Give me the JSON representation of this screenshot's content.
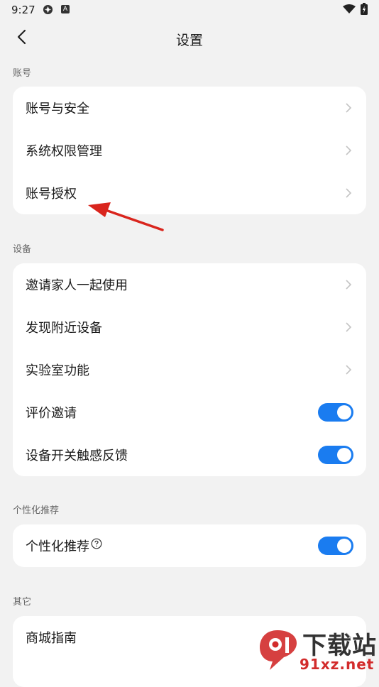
{
  "status_bar": {
    "time": "9:27"
  },
  "header": {
    "title": "设置"
  },
  "sections": {
    "account": {
      "label": "账号",
      "items": [
        {
          "label": "账号与安全",
          "control": "chevron"
        },
        {
          "label": "系统权限管理",
          "control": "chevron"
        },
        {
          "label": "账号授权",
          "control": "chevron"
        }
      ]
    },
    "device": {
      "label": "设备",
      "items": [
        {
          "label": "邀请家人一起使用",
          "control": "chevron"
        },
        {
          "label": "发现附近设备",
          "control": "chevron"
        },
        {
          "label": "实验室功能",
          "control": "chevron"
        },
        {
          "label": "评价邀请",
          "control": "toggle",
          "on": true
        },
        {
          "label": "设备开关触感反馈",
          "control": "toggle",
          "on": true
        }
      ]
    },
    "personalization": {
      "label": "个性化推荐",
      "items": [
        {
          "label": "个性化推荐",
          "control": "toggle",
          "on": true,
          "help_icon": "question-circle-icon"
        }
      ]
    },
    "other": {
      "label": "其它",
      "items": [
        {
          "label": "商城指南",
          "control": "chevron"
        }
      ]
    }
  },
  "watermark": {
    "title": "下载站",
    "domain": "91xz.net"
  },
  "colors": {
    "toggle_on": "#1a7cf0",
    "background": "#f2f2f2",
    "card": "#ffffff",
    "annotation_arrow": "#d9251d"
  }
}
